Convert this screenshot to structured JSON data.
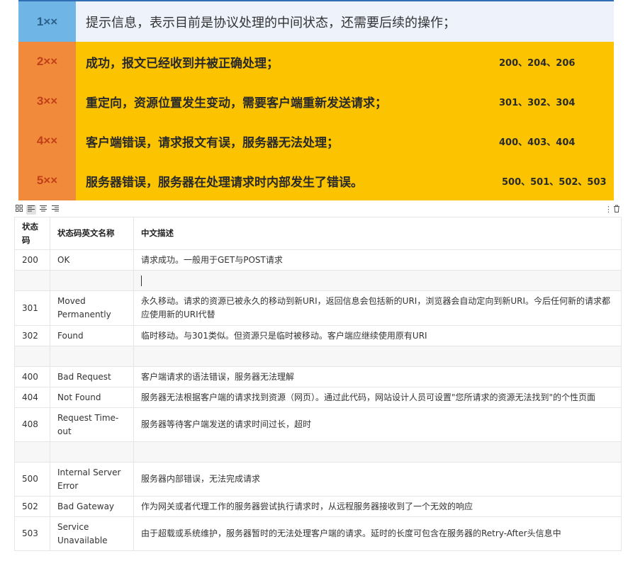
{
  "status_classes": [
    {
      "code": "1××",
      "description": "提示信息，表示目前是协议处理的中间状态，还需要后续的操作；",
      "examples": ""
    },
    {
      "code": "2××",
      "description": "成功，报文已经收到并被正确处理；",
      "examples": "200、204、206"
    },
    {
      "code": "3××",
      "description": "重定向，资源位置发生变动，需要客户端重新发送请求；",
      "examples": "301、302、304"
    },
    {
      "code": "4××",
      "description": "客户端错误，请求报文有误，服务器无法处理；",
      "examples": "400、403、404"
    },
    {
      "code": "5××",
      "description": "服务器错误，服务器在处理请求时内部发生了错误。",
      "examples": "500、501、502、503"
    }
  ],
  "toolbar": {
    "icons": [
      "grid-icon",
      "align-left-icon",
      "align-center-icon",
      "align-right-icon"
    ],
    "more_icon": "⋮",
    "delete_icon": "🗑"
  },
  "table": {
    "headers": [
      "状态码",
      "状态码英文名称",
      "中文描述"
    ],
    "rows": [
      {
        "code": "200",
        "name": "OK",
        "desc": "请求成功。一般用于GET与POST请求"
      },
      {
        "code": "",
        "name": "",
        "desc": ""
      },
      {
        "code": "301",
        "name": "Moved Permanently",
        "desc": "永久移动。请求的资源已被永久的移动到新URI，返回信息会包括新的URI，浏览器会自动定向到新URI。今后任何新的请求都应使用新的URI代替"
      },
      {
        "code": "302",
        "name": "Found",
        "desc": "临时移动。与301类似。但资源只是临时被移动。客户端应继续使用原有URI"
      },
      {
        "code": "",
        "name": "",
        "desc": ""
      },
      {
        "code": "400",
        "name": "Bad Request",
        "desc": "客户端请求的语法错误，服务器无法理解"
      },
      {
        "code": "404",
        "name": "Not Found",
        "desc": "服务器无法根据客户端的请求找到资源（网页）。通过此代码，网站设计人员可设置\"您所请求的资源无法找到\"的个性页面"
      },
      {
        "code": "408",
        "name": "Request Time-out",
        "desc": "服务器等待客户端发送的请求时间过长，超时"
      },
      {
        "code": "",
        "name": "",
        "desc": ""
      },
      {
        "code": "500",
        "name": "Internal Server Error",
        "desc": "服务器内部错误，无法完成请求"
      },
      {
        "code": "502",
        "name": "Bad Gateway",
        "desc": "作为网关或者代理工作的服务器尝试执行请求时，从远程服务器接收到了一个无效的响应"
      },
      {
        "code": "503",
        "name": "Service Unavailable",
        "desc": "由于超载或系统维护，服务器暂时的无法处理客户端的请求。延时的长度可包含在服务器的Retry-After头信息中"
      }
    ]
  },
  "colors": {
    "info_code_bg": "#6fb6e6",
    "info_desc_bg": "#eef2fb",
    "code_col_bg": "#f28a3b",
    "body_bg": "#fbc300",
    "code_text": "#c0401a"
  }
}
